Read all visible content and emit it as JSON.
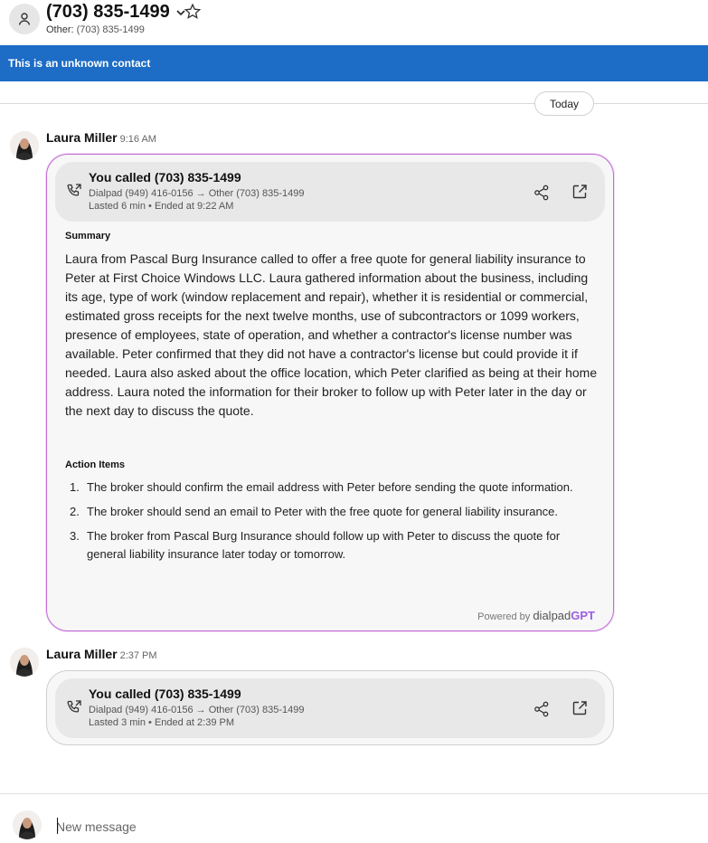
{
  "header": {
    "contact_name": "(703) 835-1499",
    "sub_label": "Other:",
    "sub_number": "(703) 835-1499"
  },
  "banner": {
    "text": "This is an unknown contact"
  },
  "date_divider": {
    "label": "Today"
  },
  "messages": [
    {
      "sender": "Laura Miller",
      "time": "9:16 AM",
      "call": {
        "title": "You called (703) 835-1499",
        "route": "Dialpad (949) 416-0156 → Other (703) 835-1499",
        "duration": "Lasted 6 min • Ended at 9:22 AM"
      },
      "summary_title": "Summary",
      "summary": "Laura from Pascal Burg Insurance called to offer a free quote for general liability insurance to Peter at First Choice Windows LLC. Laura gathered information about the business, including its age, type of work (window replacement and repair), whether it is residential or commercial, estimated gross receipts for the next twelve months, use of subcontractors or 1099 workers, presence of employees, state of operation, and whether a contractor's license number was available. Peter confirmed that they did not have a contractor's license but could provide it if needed. Laura also asked about the office location, which Peter clarified as being at their home address. Laura noted the information for their broker to follow up with Peter later in the day or the next day to discuss the quote.",
      "action_items_title": "Action Items",
      "action_items": [
        {
          "num": "1.",
          "text": "The broker should confirm the email address with Peter before sending the quote information."
        },
        {
          "num": "2.",
          "text": "The broker should send an email to Peter with the free quote for general liability insurance."
        },
        {
          "num": "3.",
          "text": "The broker from Pascal Burg Insurance should follow up with Peter to discuss the quote for general liability insurance later today or tomorrow."
        }
      ],
      "powered_by": "Powered by",
      "brand_main": "dialpad",
      "brand_gpt": "GPT"
    },
    {
      "sender": "Laura Miller",
      "time": "2:37 PM",
      "call": {
        "title": "You called (703) 835-1499",
        "route": "Dialpad (949) 416-0156 → Other (703) 835-1499",
        "duration": "Lasted 3 min • Ended at 2:39 PM"
      }
    }
  ],
  "composer": {
    "placeholder": "New message"
  },
  "colors": {
    "banner": "#1d6cc6",
    "gpt_border": "#c46bd9",
    "gpt_brand": "#9b5de5"
  },
  "icons": {
    "contact_avatar": "person-icon",
    "chevron": "chevron-down-icon",
    "favorite": "star-icon",
    "call": "phone-outgoing-icon",
    "share": "share-icon",
    "open": "external-link-icon"
  }
}
